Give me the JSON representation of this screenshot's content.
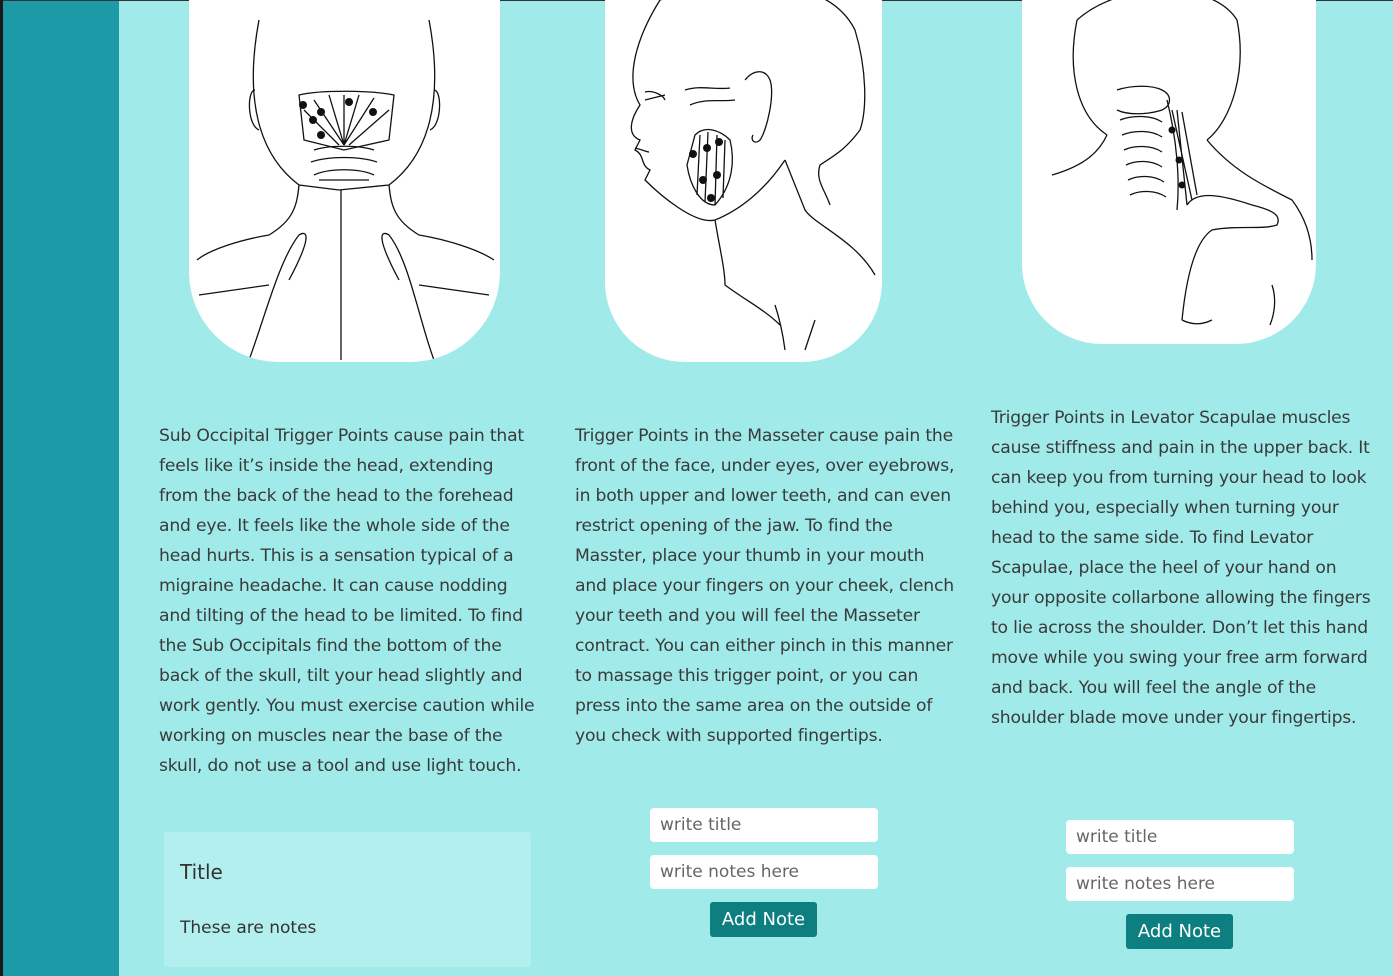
{
  "cards": [
    {
      "illustration": "suboccipital-neck-back-icon",
      "description": "Sub Occipital Trigger Points cause pain that feels like it’s inside the head, extending from the back of the head to the forehead and eye. It feels like the whole side of the head hurts. This is a sensation typical of a migraine headache. It can cause nodding and tilting of the head to be limited. To find the Sub Occipitals find the bottom of the back of the skull, tilt your head slightly and work gently. You must exercise caution while working on muscles near the base of the skull, do not use a tool and use light touch.",
      "note": {
        "title": "Title",
        "body": "These are notes"
      }
    },
    {
      "illustration": "masseter-face-side-icon",
      "description": "Trigger Points in the Masseter cause pain the front of the face, under eyes, over eyebrows, in both upper and lower teeth, and can even restrict opening of the jaw. To find the Masster, place your thumb in your mouth and place your fingers on your cheek, clench your teeth and you will feel the Masseter contract. You can either pinch in this manner to massage this trigger point, or you can press into the same area on the outside of you check with supported fingertips.",
      "form": {
        "title_placeholder": "write title",
        "notes_placeholder": "write notes here",
        "button_label": "Add Note"
      }
    },
    {
      "illustration": "levator-scapulae-back-icon",
      "description": "Trigger Points in Levator Scapulae muscles cause stiffness and pain in the upper back. It can keep you from turning your head to look behind you, especially when turning your head to the same side. To find Levator Scapulae, place the heel of your hand on your opposite collarbone allowing the fingers to lie across the shoulder. Don’t let this hand move while you swing your free arm forward and back. You will feel the angle of the shoulder blade move under your fingertips.",
      "form": {
        "title_placeholder": "write title",
        "notes_placeholder": "write notes here",
        "button_label": "Add Note"
      }
    }
  ],
  "colors": {
    "page_bg": "#a0eaea",
    "sidebar": "#1d9aa7",
    "button": "#0d7f80",
    "note_card": "#b3efee"
  }
}
